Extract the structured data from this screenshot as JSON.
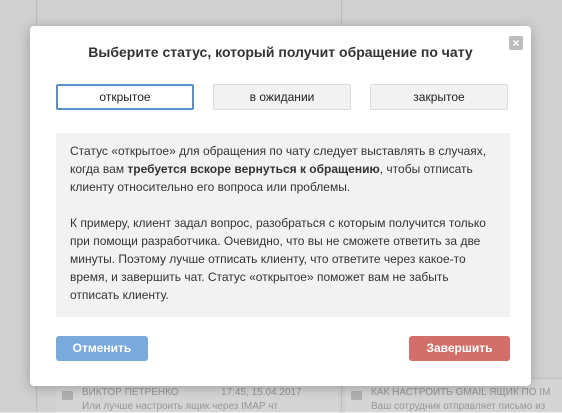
{
  "background": {
    "rows": [
      {
        "name": "ВИКТОР ПЕТРЕНКО",
        "time": "17:45, 15.04.2017",
        "preview": "Или лучше настроить ящик через IMAP чт"
      },
      {
        "name": "КАК НАСТРОИТЬ GMAIL ЯЩИК ПО IM",
        "time": "",
        "preview": "Ваш сотрудник отправляет письмо из"
      }
    ]
  },
  "modal": {
    "title": "Выберите статус, который получит обращение по чату",
    "close": "×",
    "statuses": [
      "открытое",
      "в ожидании",
      "закрытое"
    ],
    "selected_status": "открытое",
    "description": {
      "p1_a": "Статус «открытое» для обращения по чату следует выставлять в случаях, когда вам ",
      "p1_bold": "требуется вскоре вернуться к обращению",
      "p1_b": ", чтобы отписать клиенту относительно его вопроса или проблемы.",
      "p2": "К примеру, клиент задал вопрос, разобраться с которым получится только при помощи разработчика. Очевидно, что вы не сможете ответить за две минуты. Поэтому лучше отписать клиенту, что ответите через какое-то время, и завершить чат. Статус «открытое» поможет вам не забыть отписать клиенту."
    },
    "cancel_label": "Отменить",
    "finish_label": "Завершить"
  },
  "colors": {
    "accent_blue": "#7aa9dc",
    "selected_border": "#5b8fc7",
    "finish_red": "#d36f6a"
  }
}
